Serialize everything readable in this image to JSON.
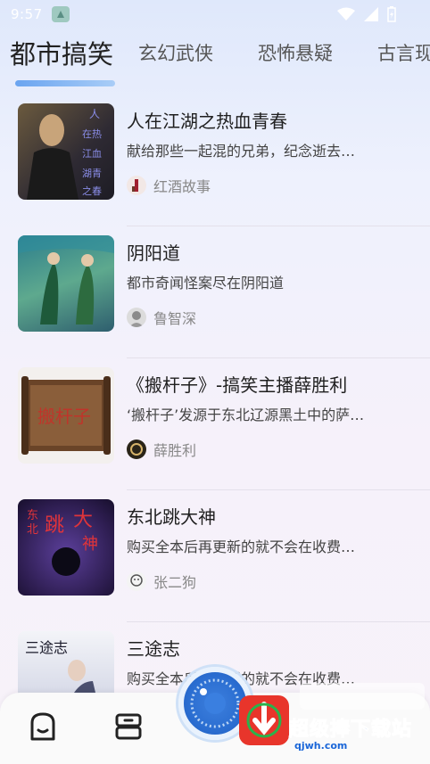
{
  "status_bar": {
    "time": "9:57"
  },
  "tabs": [
    {
      "label": "都市搞笑",
      "active": true
    },
    {
      "label": "玄幻武侠",
      "active": false
    },
    {
      "label": "恐怖悬疑",
      "active": false
    },
    {
      "label": "古言现",
      "active": false
    }
  ],
  "books": [
    {
      "title": "人在江湖之热血青春",
      "desc": "献给那些一起混的兄弟，纪念逝去…",
      "author": "红酒故事",
      "cover_text": "人在热江血湖青之春"
    },
    {
      "title": "阴阳道",
      "desc": "都市奇闻怪案尽在阴阳道",
      "author": "鲁智深"
    },
    {
      "title": "《搬杆子》-搞笑主播薛胜利",
      "desc": "‘搬杆子’发源于东北辽源黑土中的萨…",
      "author": "薛胜利",
      "cover_text": "搬杆子"
    },
    {
      "title": "东北跳大神",
      "desc": "购买全本后再更新的就不会在收费…",
      "author": "张二狗",
      "cover_text": "东北跳大神"
    },
    {
      "title": "三途志",
      "desc": "购买全本后再更新的就不会在收费…",
      "author": "",
      "cover_text": "三途志"
    }
  ],
  "watermark": {
    "text": "超级捧下载站",
    "url": "qjwh.com"
  },
  "colors": {
    "accent": "#2b6ed1",
    "tab_indicator": "#6aa4f0"
  }
}
